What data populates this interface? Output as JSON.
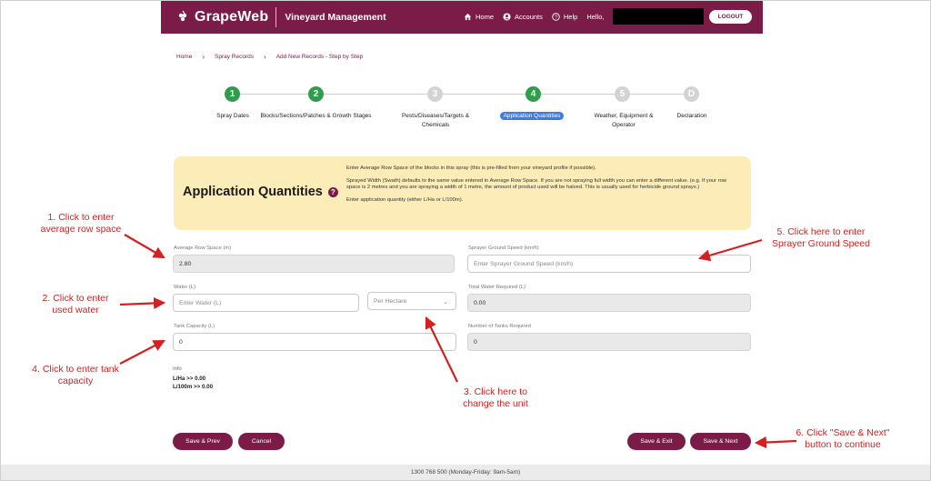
{
  "header": {
    "logo": "GrapeWeb",
    "app_title": "Vineyard Management",
    "nav": [
      "Home",
      "Accounts",
      "Help"
    ],
    "hello": "Hello,",
    "logout": "LOGOUT"
  },
  "breadcrumb": [
    "Home",
    "Spray Records",
    "Add New Records - Step by Step"
  ],
  "steps": [
    {
      "num": "1",
      "label": "Spray Dates"
    },
    {
      "num": "2",
      "label": "Blocks/Sections/Patches & Growth Stages"
    },
    {
      "num": "3",
      "label": "Pests/Diseases/Targets & Chemicals"
    },
    {
      "num": "4",
      "label": "Application Quantities"
    },
    {
      "num": "5",
      "label": "Weather, Equipment & Operator"
    },
    {
      "num": "D",
      "label": "Declaration"
    }
  ],
  "info": {
    "title": "Application Quantities",
    "help_glyph": "?",
    "p1": "Enter Average Row Space of the blocks in this spray (this is pre-filled from your vineyard profile if possible).",
    "p2": "Sprayed Width (Swath) defaults to the same value entered in Average Row Space. If you are not spraying full width you can enter a different value. (e.g. If your row space is 2 metres and you are spraying a width of 1 metre, the amount of product used will be halved. This is usually used for herbicide ground sprays.)",
    "p3": "Enter application quantity (either L/Ha or L/100m)."
  },
  "form": {
    "row_space_label": "Average Row Space (m)",
    "row_space_value": "2.80",
    "ground_speed_label": "Sprayer Ground Speed (km/h)",
    "ground_speed_placeholder": "Enter Sprayer Ground Speed (km/h)",
    "water_label": "Water (L)",
    "water_placeholder": "Enter Water (L)",
    "unit_value": "Per Hectare",
    "total_water_label": "Total Water Required (L)",
    "total_water_value": "0.00",
    "tank_label": "Tank Capacity (L)",
    "tank_value": "0",
    "tanks_required_label": "Number of Tanks Required",
    "tanks_required_value": "0",
    "info_label": "Info",
    "l_ha": "L/Ha >> 0.00",
    "l_100m": "L/100m >> 0.00"
  },
  "buttons": {
    "save_prev": "Save & Prev",
    "cancel": "Cancel",
    "save_exit": "Save & Exit",
    "save_next": "Save & Next"
  },
  "footer": "1300 768 500 (Monday-Friday: 9am-5am)",
  "annotations": {
    "a1": "1. Click to enter average row space",
    "a2": "2. Click to enter used water",
    "a3": "3. Click here to change the unit",
    "a4": "4. Click to enter tank capacity",
    "a5": "5. Click here to enter Sprayer Ground Speed",
    "a6": "6. Click \"Save & Next\" button to continue"
  },
  "colors": {
    "brand": "#7b1b48",
    "done": "#2e9e4a",
    "active": "#3d7be0",
    "annotation": "#d42020"
  }
}
